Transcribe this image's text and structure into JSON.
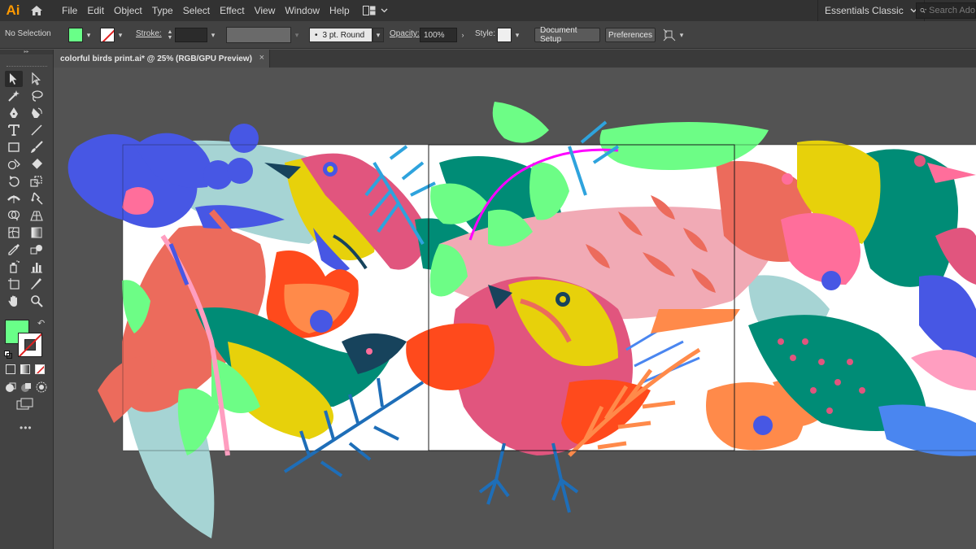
{
  "app": {
    "logo": "Ai",
    "menu": [
      "File",
      "Edit",
      "Object",
      "Type",
      "Select",
      "Effect",
      "View",
      "Window",
      "Help"
    ],
    "workspace": "Essentials Classic",
    "search_placeholder": "Search Ado"
  },
  "control_bar": {
    "selection": "No Selection",
    "fill_color": "#69ff88",
    "stroke_label": "Stroke:",
    "brush": "3 pt. Round",
    "brush_bullet": "•",
    "opacity_label": "Opacity:",
    "opacity_value": "100%",
    "style_label": "Style:",
    "document_setup": "Document Setup",
    "preferences": "Preferences"
  },
  "document": {
    "tab_title": "colorful birds print.ai* @ 25% (RGB/GPU Preview)",
    "close": "×"
  },
  "toolbox": {
    "tools": [
      "selection-tool",
      "direct-selection-tool",
      "magic-wand-tool",
      "lasso-tool",
      "pen-tool",
      "curvature-tool",
      "type-tool",
      "line-segment-tool",
      "rectangle-tool",
      "paintbrush-tool",
      "shaper-tool",
      "eraser-tool",
      "rotate-tool",
      "scale-tool",
      "width-tool",
      "free-transform-tool",
      "shape-builder-tool",
      "perspective-grid-tool",
      "mesh-tool",
      "gradient-tool",
      "eyedropper-tool",
      "blend-tool",
      "symbol-sprayer-tool",
      "column-graph-tool",
      "artboard-tool",
      "slice-tool",
      "hand-tool",
      "zoom-tool"
    ],
    "fill_color": "#69ff88",
    "more": "•••"
  },
  "colors": {
    "accent": "#ff9a00",
    "panel": "#434343",
    "menubar": "#323232",
    "canvas": "#535353"
  }
}
